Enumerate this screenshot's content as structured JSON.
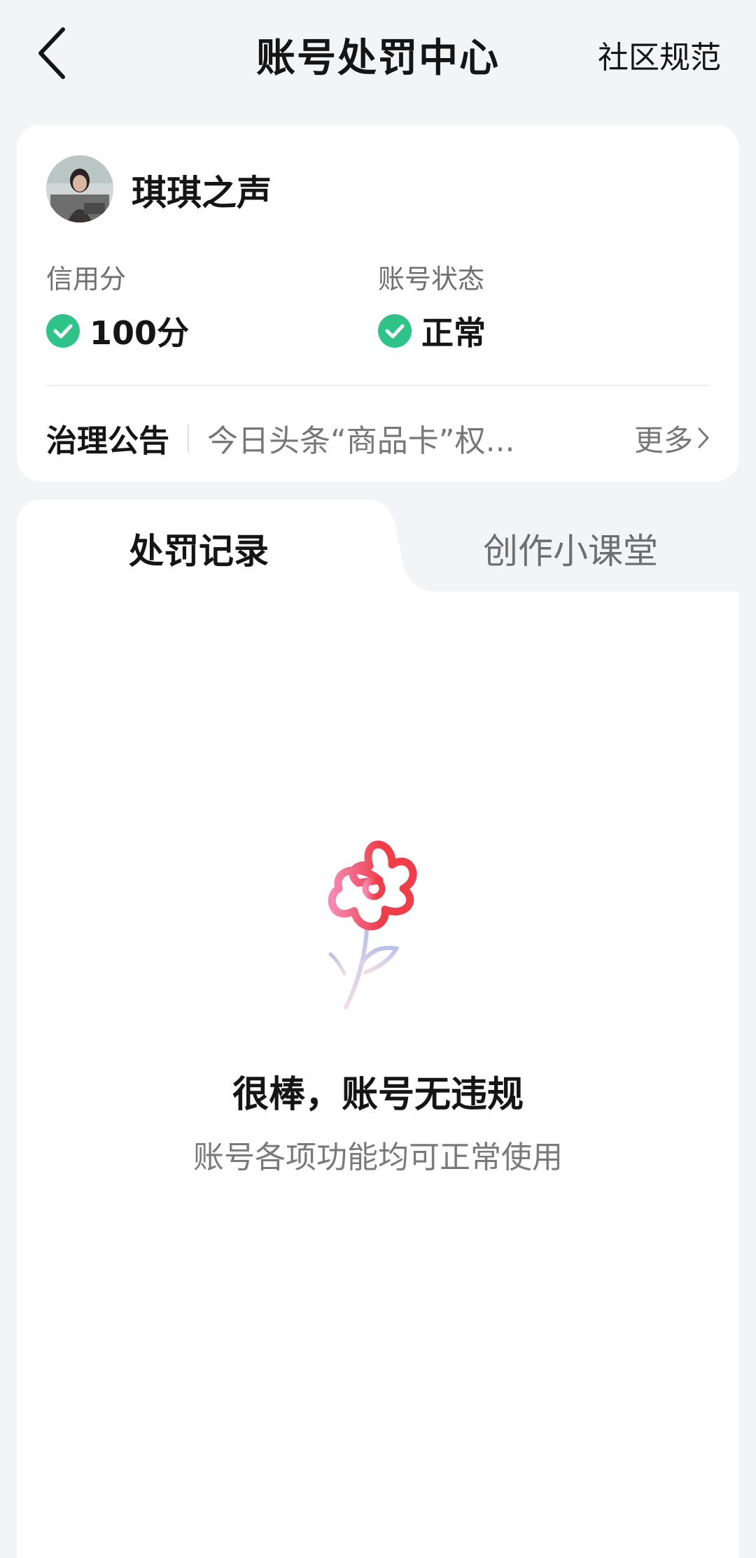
{
  "header": {
    "title": "账号处罚中心",
    "right_link": "社区规范"
  },
  "profile": {
    "nickname": "琪琪之声"
  },
  "stats": {
    "credit_label": "信用分",
    "credit_value": "100分",
    "status_label": "账号状态",
    "status_value": "正常"
  },
  "notice": {
    "label": "治理公告",
    "text": "今日头条“商品卡”权...",
    "more": "更多"
  },
  "tabs": [
    {
      "label": "处罚记录",
      "active": true
    },
    {
      "label": "创作小课堂",
      "active": false
    }
  ],
  "empty_state": {
    "title": "很棒，账号无违规",
    "subtitle": "账号各项功能均可正常使用"
  },
  "colors": {
    "check_green": "#2fc38a",
    "flower_red": "#ef3e4a",
    "flower_pink": "#f589b4"
  },
  "icons": [
    "back-arrow-icon",
    "check-icon",
    "chevron-right-icon",
    "flower-illustration"
  ]
}
